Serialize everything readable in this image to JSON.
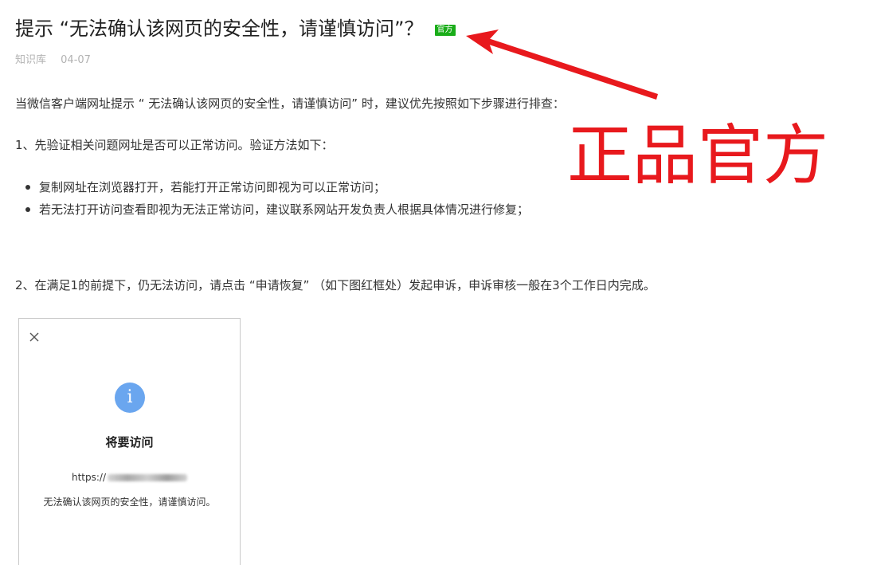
{
  "article": {
    "title": "提示 “无法确认该网页的安全性，请谨慎访问”？",
    "badge": "官方",
    "source": "知识库",
    "date": "04-07",
    "intro": "当微信客户端网址提示 “ 无法确认该网页的安全性，请谨慎访问” 时，建议优先按照如下步骤进行排查：",
    "step1": "1、先验证相关问题网址是否可以正常访问。验证方法如下：",
    "bullets": [
      "复制网址在浏览器打开，若能打开正常访问即视为可以正常访问；",
      "若无法打开访问查看即视为无法正常访问，建议联系网站开发负责人根据具体情况进行修复；"
    ],
    "step2": "2、在满足1的前提下，仍无法访问，请点击 “申请恢复” （如下图红框处）发起申诉，申诉审核一般在3个工作日内完成。"
  },
  "screenshot_card": {
    "close_icon": "close-icon",
    "info_icon": "info-icon",
    "info_glyph": "i",
    "heading": "将要访问",
    "url_prefix": "https://",
    "warning": "无法确认该网页的安全性，请谨慎访问。"
  },
  "annotation": {
    "text": "正品官方",
    "color": "#e8191d"
  },
  "colors": {
    "badge": "#1aad19",
    "info_icon": "#6aa6ef",
    "meta": "#b2b2b2",
    "body_text": "#333333"
  }
}
